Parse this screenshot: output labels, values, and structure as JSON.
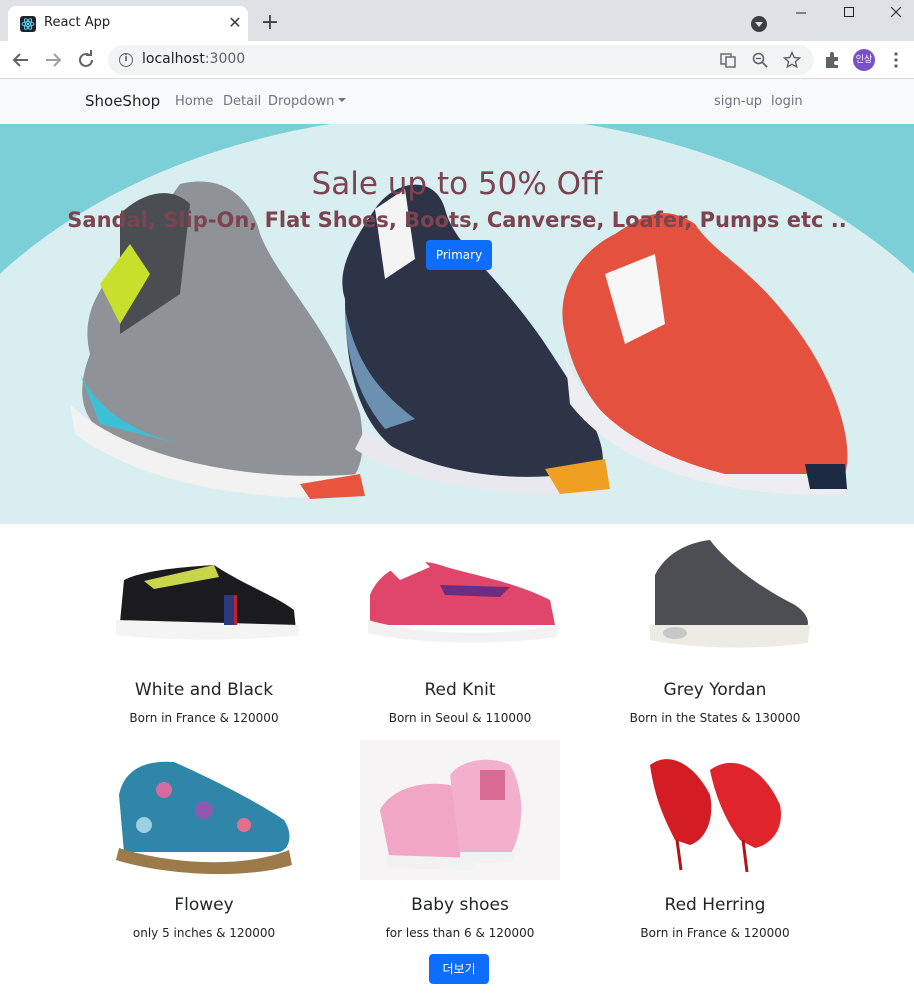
{
  "browser": {
    "tab_title": "React App",
    "tab_close": "✕",
    "new_tab": "+",
    "url_host": "localhost",
    "url_port": ":3000",
    "profile_label": "인상",
    "icons": [
      "react-favicon",
      "tab-search-icon",
      "minimize-icon",
      "maximize-icon",
      "close-icon",
      "back-icon",
      "forward-icon",
      "reload-icon",
      "info-icon",
      "translate-icon",
      "zoom-icon",
      "star-icon",
      "extensions-icon",
      "menu-icon"
    ]
  },
  "navbar": {
    "brand": "ShoeShop",
    "links": [
      "Home",
      "Detail",
      "Dropdown"
    ],
    "right_links": [
      "sign-up",
      "login"
    ]
  },
  "hero": {
    "title": "Sale up to 50% Off",
    "subtitle": "Sandal, Slip-On, Flat Shoes, Boots, Canverse, Loafer, Pumps etc ..",
    "button": "Primary",
    "colors": {
      "bg": "#7ccfd7",
      "arc": "#d8eef0",
      "text": "#7b4450"
    }
  },
  "products": [
    {
      "name": "White and Black",
      "desc": "Born in France & 120000"
    },
    {
      "name": "Red Knit",
      "desc": "Born in Seoul & 110000"
    },
    {
      "name": "Grey Yordan",
      "desc": "Born in the States & 130000"
    },
    {
      "name": "Flowey",
      "desc": "only 5 inches & 120000"
    },
    {
      "name": "Baby shoes",
      "desc": "for less than 6 & 120000"
    },
    {
      "name": "Red Herring",
      "desc": "Born in France & 120000"
    }
  ],
  "more_button": "더보기",
  "accent": "#0d6efd"
}
